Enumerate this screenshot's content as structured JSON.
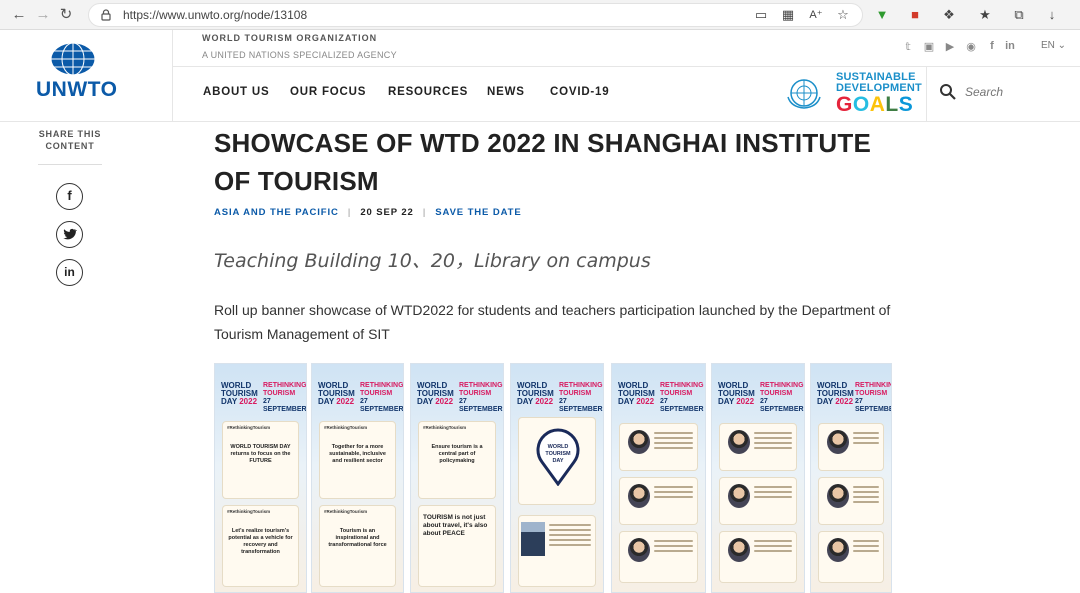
{
  "browser": {
    "url": "https://www.unwto.org/node/13108"
  },
  "header": {
    "logo_text": "UNWTO",
    "org_name": "WORLD TOURISM ORGANIZATION",
    "org_sub": "A UNITED NATIONS SPECIALIZED AGENCY",
    "language": "EN",
    "nav": [
      {
        "label": "ABOUT US"
      },
      {
        "label": "OUR FOCUS"
      },
      {
        "label": "RESOURCES"
      },
      {
        "label": "NEWS"
      },
      {
        "label": "COVID-19"
      }
    ],
    "sdg": {
      "line1": "SUSTAINABLE",
      "line2": "DEVELOPMENT",
      "line3": "GOALS"
    },
    "search_placeholder": "Search"
  },
  "share": {
    "title": "SHARE THIS CONTENT",
    "buttons": [
      "f",
      "t",
      "in"
    ]
  },
  "article": {
    "title": "SHOWCASE OF WTD 2022 IN SHANGHAI INSTITUTE OF TOURISM",
    "region": "ASIA AND THE PACIFIC",
    "date": "20 SEP 22",
    "tag": "SAVE THE DATE",
    "subtitle": "Teaching Building 10、20，Library on campus",
    "body": "Roll up banner showcase of WTD2022 for students and teachers participation launched by the Department of Tourism Management of SIT"
  },
  "banners": {
    "wtd": "WORLD TOURISM DAY",
    "year": "2022",
    "rethinking": "RETHINKING TOURISM",
    "date": "27 SEPTEMBER",
    "hashtag": "#RethinkingTourism",
    "b1_top": "WORLD TOURISM DAY returns to focus on the FUTURE",
    "b1_bottom": "Let's realize tourism's potential as a vehicle for recovery and transformation",
    "b2_top": "Together for a more sustainable, inclusive and resilient sector",
    "b2_bottom": "Tourism is an inspirational and transformational force",
    "b3_top": "Ensure tourism is a central part of policymaking",
    "b3_bottom": "TOURISM is not just about travel, it's also about PEACE",
    "b4_pin": "WORLD TOURISM DAY"
  }
}
